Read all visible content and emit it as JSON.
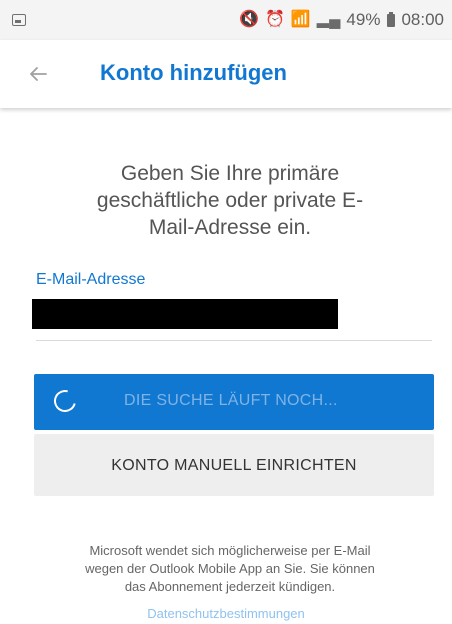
{
  "status_bar": {
    "left_icon": "image-icon",
    "icons": [
      "mute-icon",
      "alarm-icon",
      "wifi-icon",
      "signal-icon"
    ],
    "battery": "49%",
    "battery_icon": "battery-icon",
    "time": "08:00"
  },
  "header": {
    "back_icon": "back-arrow-icon",
    "title": "Konto hinzufügen"
  },
  "main": {
    "instruction": "Geben Sie Ihre primäre geschäftliche oder private E-Mail-Adresse ein.",
    "email_label": "E-Mail-Adresse",
    "primary_button": "DIE SUCHE LÄUFT NOCH...",
    "secondary_button": "KONTO MANUELL EINRICHTEN"
  },
  "footer": {
    "disclaimer": "Microsoft wendet sich möglicherweise per E-Mail wegen der Outlook Mobile App an Sie. Sie können das Abonnement jederzeit kündigen.",
    "privacy_link": "Datenschutzbestimmungen"
  },
  "colors": {
    "accent": "#1277d1",
    "button_primary": "#1178d1",
    "button_secondary": "#eeeeee"
  }
}
